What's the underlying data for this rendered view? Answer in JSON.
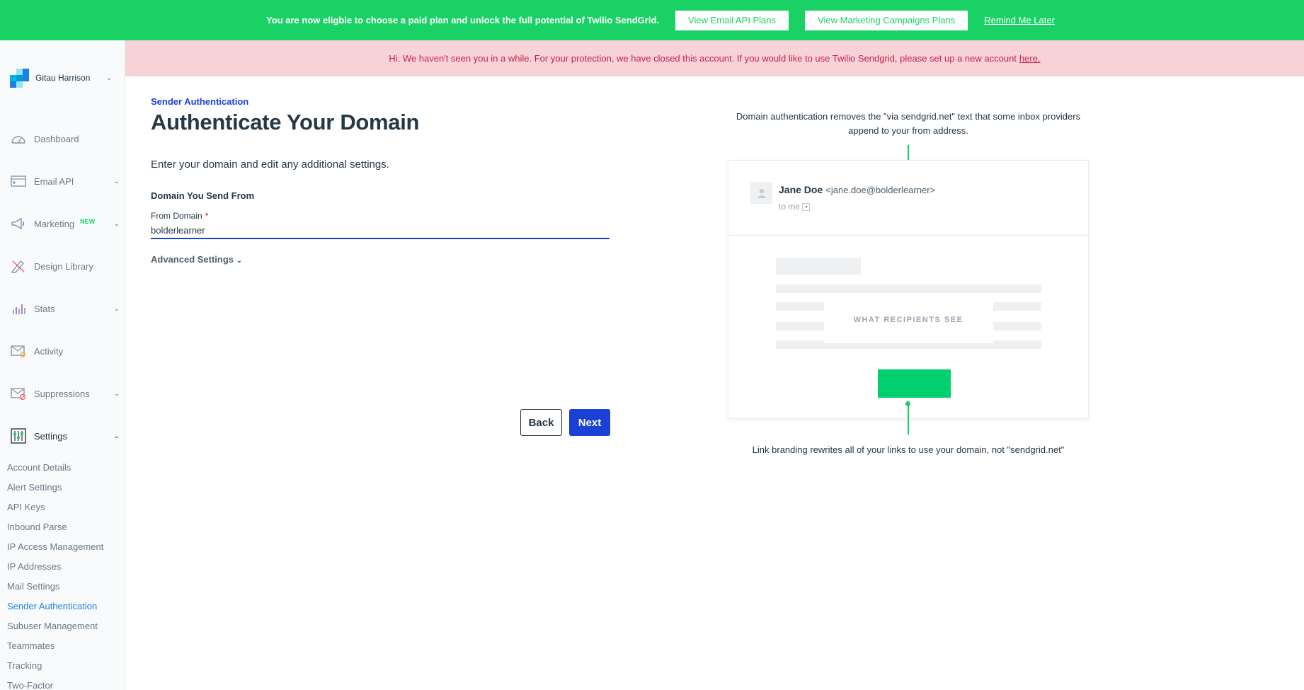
{
  "banner": {
    "message": "You are now eligble to choose a paid plan and unlock the full potential of Twilio SendGrid.",
    "email_api_btn": "View Email API Plans",
    "marketing_btn": "View Marketing Campaigns Plans",
    "remind_link": "Remind Me Later",
    "color": "#1ad165"
  },
  "account": {
    "name": "Gitau Harrison"
  },
  "nav": {
    "dashboard": "Dashboard",
    "email_api": "Email API",
    "marketing": "Marketing",
    "marketing_badge": "NEW",
    "design_library": "Design Library",
    "stats": "Stats",
    "activity": "Activity",
    "suppressions": "Suppressions",
    "settings": "Settings"
  },
  "settings_items": [
    "Account Details",
    "Alert Settings",
    "API Keys",
    "Inbound Parse",
    "IP Access Management",
    "IP Addresses",
    "Mail Settings",
    "Sender Authentication",
    "Subuser Management",
    "Teammates",
    "Tracking",
    "Two-Factor"
  ],
  "alert": {
    "text": "Hi. We haven't seen you in a while. For your protection, we have closed this account. If you would like to use Twilio Sendgrid, please set up a new account",
    "link": "here."
  },
  "form": {
    "breadcrumb": "Sender Authentication",
    "title": "Authenticate Your Domain",
    "intro": "Enter your domain and edit any additional settings.",
    "section_label": "Domain You Send From",
    "field_label": "From Domain",
    "required_mark": "*",
    "domain_value": "bolderlearner",
    "advanced": "Advanced Settings",
    "back": "Back",
    "next": "Next"
  },
  "illustration": {
    "note_top": "Domain authentication removes the \"via sendgrid.net\" text that some inbox providers append to your from address.",
    "sender_name": "Jane Doe",
    "sender_email": "<jane.doe@bolderlearner>",
    "to": "to me",
    "what_recipients_see": "WHAT RECIPIENTS SEE",
    "note_bottom": "Link branding rewrites all of your links to use your domain, not \"sendgrid.net\""
  }
}
